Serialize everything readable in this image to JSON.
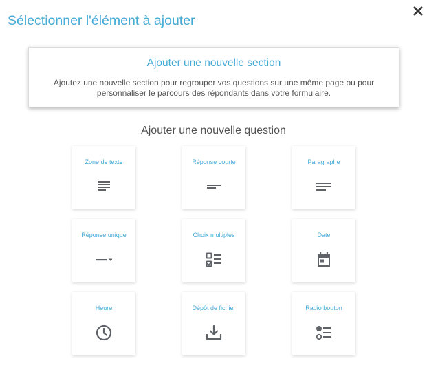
{
  "dialog": {
    "title": "Sélectionner l'élément à ajouter",
    "close_icon": "close-x-icon"
  },
  "section": {
    "title": "Ajouter une nouvelle section",
    "description": "Ajoutez une nouvelle section pour regrouper vos questions sur une même page ou pour personnaliser le parcours des répondants dans votre formulaire."
  },
  "questions": {
    "heading": "Ajouter une nouvelle question",
    "items": [
      {
        "label": "Zone de texte",
        "icon": "text-area-icon"
      },
      {
        "label": "Réponse courte",
        "icon": "short-answer-icon"
      },
      {
        "label": "Paragraphe",
        "icon": "paragraph-icon"
      },
      {
        "label": "Réponse unique",
        "icon": "dropdown-icon"
      },
      {
        "label": "Choix multiples",
        "icon": "checklist-icon"
      },
      {
        "label": "Date",
        "icon": "calendar-icon"
      },
      {
        "label": "Heure",
        "icon": "clock-icon"
      },
      {
        "label": "Dépôt de fichier",
        "icon": "file-upload-icon"
      },
      {
        "label": "Radio bouton",
        "icon": "radio-list-icon"
      }
    ]
  },
  "colors": {
    "accent": "#45aad6",
    "icon": "#5f6368",
    "text": "#555555"
  }
}
